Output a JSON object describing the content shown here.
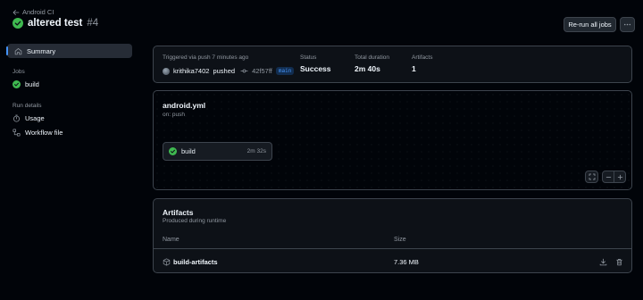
{
  "header": {
    "back_label": "Android CI",
    "title": "altered test",
    "run_number": "#4",
    "rerun_label": "Re-run all jobs"
  },
  "sidebar": {
    "summary_label": "Summary",
    "jobs_heading": "Jobs",
    "job_label": "build",
    "run_details_heading": "Run details",
    "usage_label": "Usage",
    "workflow_file_label": "Workflow file"
  },
  "summary": {
    "trigger_text": "Triggered via push 7 minutes ago",
    "actor": "krithika7402",
    "action": "pushed",
    "commit": "42f57ff",
    "branch": "main",
    "status_label": "Status",
    "status_value": "Success",
    "duration_label": "Total duration",
    "duration_value": "2m 40s",
    "artifacts_label": "Artifacts",
    "artifacts_value": "1"
  },
  "workflow": {
    "file_name": "android.yml",
    "trigger": "on: push",
    "job_name": "build",
    "job_duration": "2m 32s"
  },
  "artifacts": {
    "title": "Artifacts",
    "subtitle": "Produced during runtime",
    "col_name": "Name",
    "col_size": "Size",
    "rows": [
      {
        "name": "build-artifacts",
        "size": "7.36 MB"
      }
    ]
  },
  "colors": {
    "success": "#3fb950",
    "accent": "#4493f8",
    "background": "#010409",
    "card": "#0d1117",
    "border": "#3d444d"
  }
}
